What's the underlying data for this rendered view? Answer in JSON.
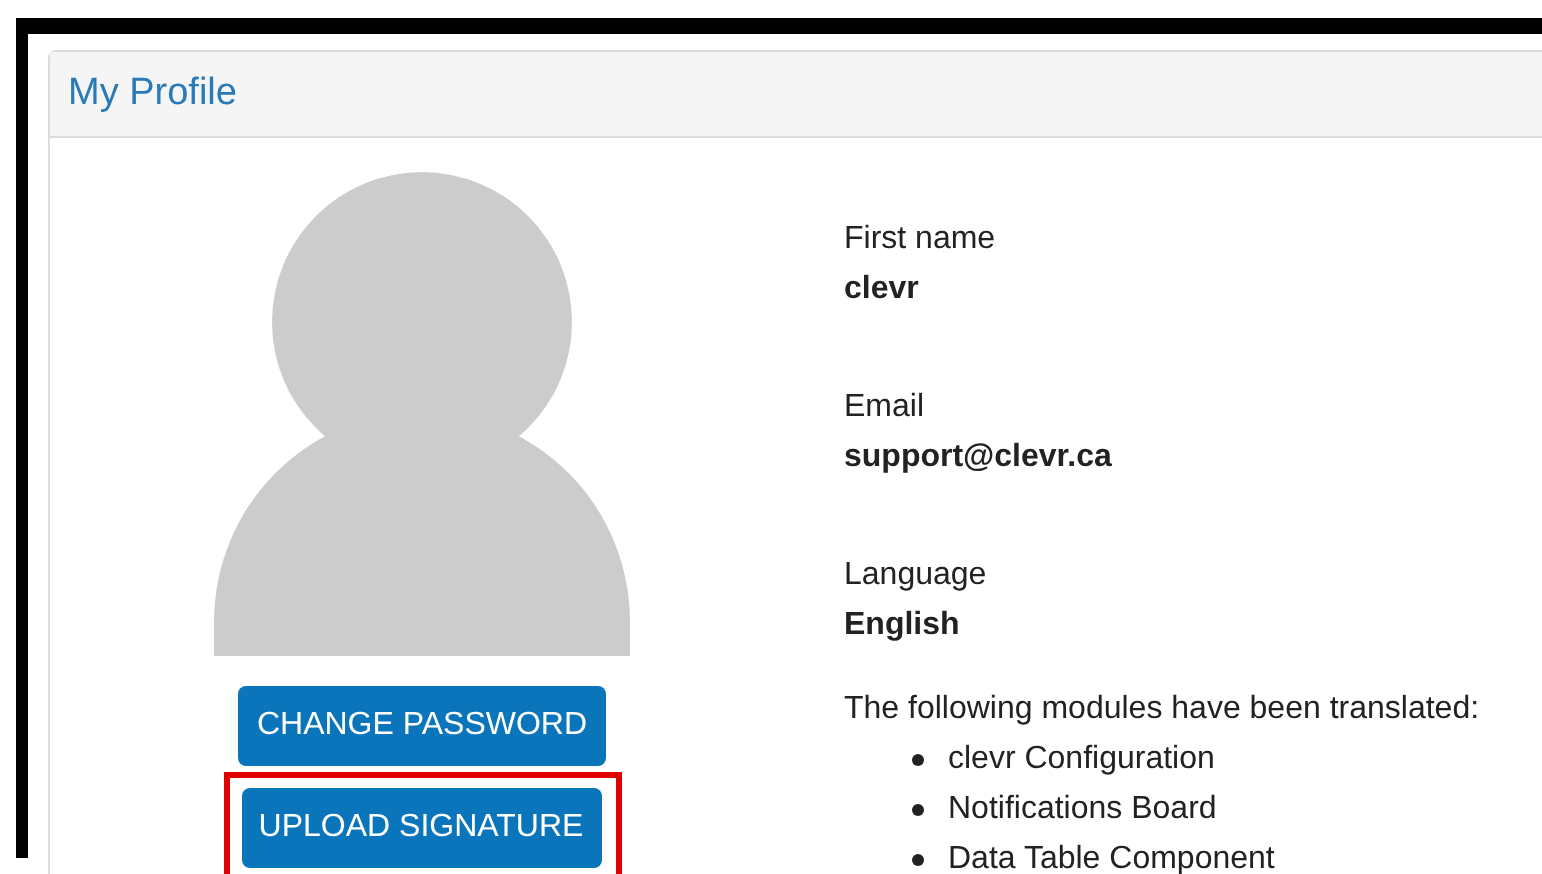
{
  "panel": {
    "title": "My Profile"
  },
  "buttons": [
    {
      "label": "CHANGE PASSWORD",
      "highlighted": false
    },
    {
      "label": "UPLOAD SIGNATURE",
      "highlighted": true
    }
  ],
  "fields": [
    {
      "label": "First name",
      "value": "clevr"
    },
    {
      "label": "Email",
      "value": "support@clevr.ca"
    },
    {
      "label": "Language",
      "value": "English"
    }
  ],
  "modules": {
    "intro": "The following modules have been translated:",
    "items": [
      "clevr Configuration",
      "Notifications Board",
      "Data Table Component"
    ]
  }
}
